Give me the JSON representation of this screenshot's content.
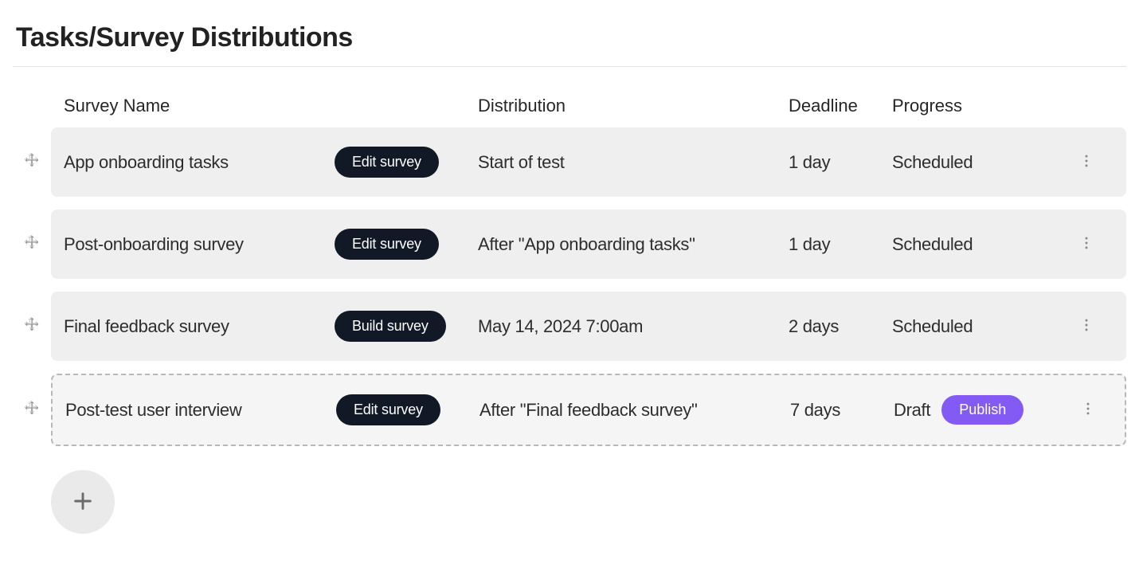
{
  "page_title": "Tasks/Survey Distributions",
  "columns": {
    "survey_name": "Survey Name",
    "distribution": "Distribution",
    "deadline": "Deadline",
    "progress": "Progress"
  },
  "publish_label": "Publish",
  "rows": [
    {
      "name": "App onboarding tasks",
      "action_label": "Edit survey",
      "distribution": "Start of test",
      "deadline": "1 day",
      "progress": "Scheduled",
      "is_draft": false
    },
    {
      "name": "Post-onboarding survey",
      "action_label": "Edit survey",
      "distribution": "After \"App onboarding tasks\"",
      "deadline": "1 day",
      "progress": "Scheduled",
      "is_draft": false
    },
    {
      "name": "Final feedback survey",
      "action_label": "Build survey",
      "distribution": "May 14, 2024 7:00am",
      "deadline": "2 days",
      "progress": "Scheduled",
      "is_draft": false
    },
    {
      "name": "Post-test user interview",
      "action_label": "Edit survey",
      "distribution": "After \"Final feedback survey\"",
      "deadline": "7 days",
      "progress": "Draft",
      "is_draft": true
    }
  ]
}
